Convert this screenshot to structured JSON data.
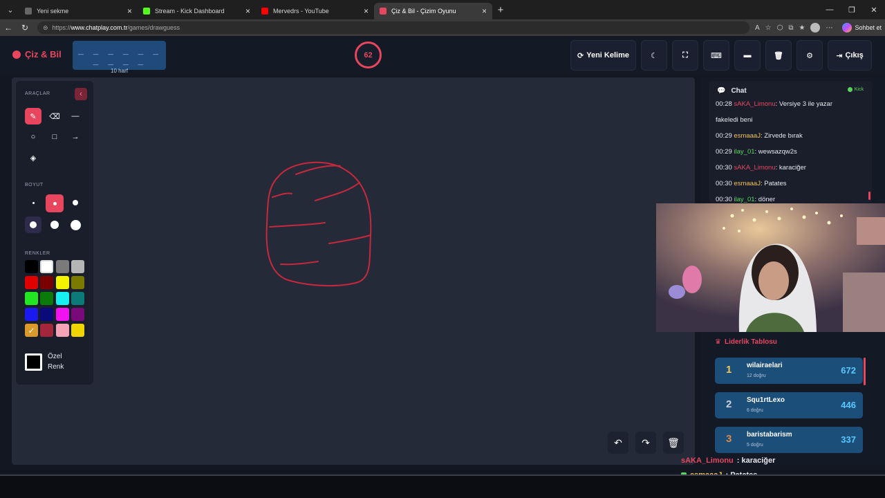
{
  "browser": {
    "tabs": [
      {
        "label": "Yeni sekme",
        "fav": "#666666"
      },
      {
        "label": "Stream - Kick Dashboard",
        "fav": "#53fc18"
      },
      {
        "label": "Mervedrs - YouTube",
        "fav": "#ff0000"
      },
      {
        "label": "Çiz & Bil - Çizim Oyunu",
        "fav": "#e8465f"
      }
    ],
    "url_prefix": "https://",
    "url_domain": "www.chatplay.com.tr",
    "url_path": "/games/drawguess",
    "sohbet": "Sohbet et"
  },
  "header": {
    "logo": "Çiz & Bil",
    "word_mask": "_ _ _ _ _ _ _ _ _ _",
    "word_hint": "10 harf",
    "timer": "62",
    "new_word": "Yeni Kelime",
    "exit": "Çıkış"
  },
  "tools": {
    "araclar": "ARAÇLAR",
    "boyut": "BOYUT",
    "renkler": "RENKLER",
    "custom_color": "Özel\nRenk",
    "colors": [
      "#000000",
      "#ffffff",
      "#7a7a7a",
      "#b5b5b5",
      "#e00000",
      "#7a0000",
      "#f4f400",
      "#7a7a00",
      "#22e622",
      "#0a7a0a",
      "#17f0f0",
      "#0d7a7a",
      "#1a1af0",
      "#0a0a7a",
      "#f012f0",
      "#7a0a7a",
      "#d99a2b",
      "#a3263a",
      "#f5a3b6",
      "#f0d400"
    ]
  },
  "chat": {
    "title": "Chat",
    "platform": "Kick",
    "messages": [
      {
        "time": "00:28",
        "user": "sAKA_Limonu",
        "user_color": "#e8465f",
        "text": ": Versiye 3 ile yazar"
      },
      {
        "time": "",
        "user": "",
        "user_color": "#e6e8ee",
        "text": "fakeledi beni"
      },
      {
        "time": "00:29",
        "user": "esmaaaJ",
        "user_color": "#f2c14e",
        "text": ": Zirvede bırak"
      },
      {
        "time": "00:29",
        "user": "ilay_01",
        "user_color": "#58d65c",
        "text": ": wewsazqw2s"
      },
      {
        "time": "00:30",
        "user": "sAKA_Limonu",
        "user_color": "#e8465f",
        "text": ": karaciğer"
      },
      {
        "time": "00:30",
        "user": "esmaaaJ",
        "user_color": "#f2c14e",
        "text": ": Patates"
      },
      {
        "time": "00:30",
        "user": "ilay_01",
        "user_color": "#58d65c",
        "text": ": döner"
      }
    ]
  },
  "leaderboard": {
    "title": "Liderlik Tablosu",
    "rows": [
      {
        "rank": "1",
        "rank_color": "#f2c94c",
        "name": "wilairaelari",
        "sub": "12 doğru",
        "score": "672"
      },
      {
        "rank": "2",
        "rank_color": "#c9d2dd",
        "name": "Squ1rtLexo",
        "sub": "6 doğru",
        "score": "446"
      },
      {
        "rank": "3",
        "rank_color": "#d9894a",
        "name": "baristabarism",
        "sub": "5 doğru",
        "score": "337"
      }
    ]
  },
  "overlay_chat": [
    {
      "user": "sAKA_Limonu",
      "color": "#e8465f",
      "text": " : karaciğer",
      "badge": false
    },
    {
      "user": "esmaaaJ",
      "color": "#f2c14e",
      "text": " : Patates",
      "badge": true
    },
    {
      "user": "ilay_01",
      "color": "#58d65c",
      "text": " : döner",
      "badge": true
    }
  ],
  "accent": "#e8465f"
}
